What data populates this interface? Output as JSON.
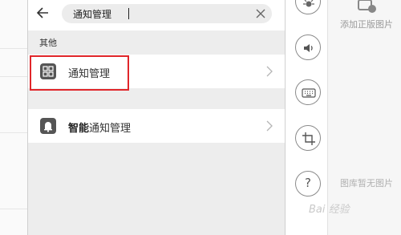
{
  "search": {
    "query": "通知管理"
  },
  "results": {
    "section_label": "其他",
    "items": [
      {
        "label": "通知管理"
      },
      {
        "label_bold": "智能",
        "label_rest": "通知管理"
      }
    ]
  },
  "tools": {
    "help_symbol": "?"
  },
  "right_panel": {
    "add_genuine_image": "添加正版图片",
    "no_images": "图库暂无图片"
  },
  "watermark": "Bai 经验",
  "colors": {
    "highlight": "#e0262a",
    "panel_bg": "#ededed"
  }
}
